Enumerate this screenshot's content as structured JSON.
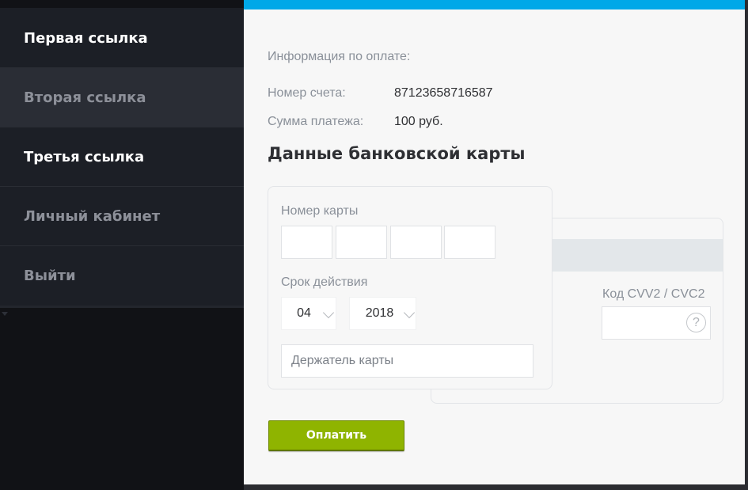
{
  "sidebar": {
    "items": [
      {
        "label": "Первая ссылка"
      },
      {
        "label": "Вторая ссылка"
      },
      {
        "label": "Третья ссылка"
      },
      {
        "label": "Личный кабинет"
      },
      {
        "label": "Выйти"
      }
    ]
  },
  "payment_info": {
    "title": "Информация по оплате:",
    "account_label": "Номер счета:",
    "account_value": "87123658716587",
    "amount_label": "Сумма платежа:",
    "amount_value": "100 руб."
  },
  "card": {
    "heading": "Данные банковской карты",
    "number_label": "Номер карты",
    "expiry_label": "Срок действия",
    "month": "04",
    "year": "2018",
    "holder_placeholder": "Держатель карты",
    "cvv_label": "Код CVV2 / CVC2",
    "help_glyph": "?"
  },
  "pay_button": {
    "label": "Оплатить"
  },
  "colors": {
    "accent_top_bar": "#00a8e8",
    "pay_button": "#8fb400",
    "sidebar_bg": "#1c1f26"
  }
}
